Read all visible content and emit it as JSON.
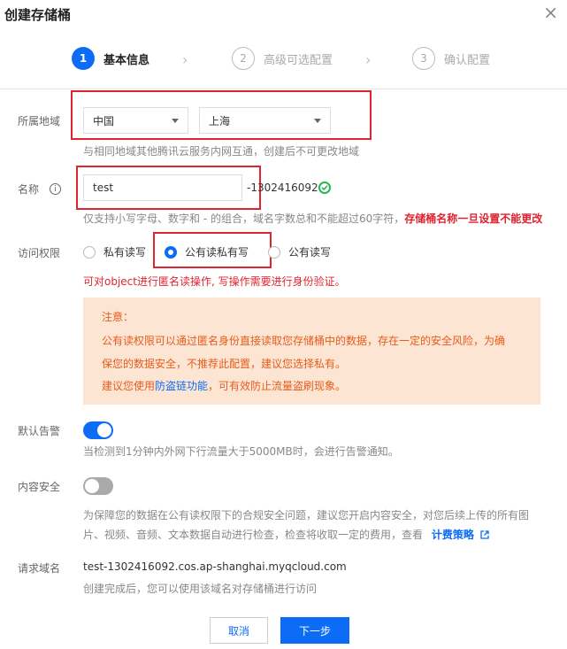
{
  "dialog": {
    "title": "创建存储桶",
    "close_glyph": "×"
  },
  "steps": [
    {
      "num": "1",
      "label": "基本信息"
    },
    {
      "num": "2",
      "label": "高级可选配置"
    },
    {
      "num": "3",
      "label": "确认配置"
    }
  ],
  "region": {
    "label": "所属地域",
    "country": "中国",
    "city": "上海",
    "hint": "与相同地域其他腾讯云服务内网互通，创建后不可更改地域"
  },
  "name": {
    "label": "名称",
    "value": "test",
    "suffix": "-1302416092",
    "hint": "仅支持小写字母、数字和 - 的组合，域名字数总和不能超过60字符，",
    "warning": "存储桶名称一旦设置不能更改"
  },
  "access": {
    "label": "访问权限",
    "options": [
      "私有读写",
      "公有读私有写",
      "公有读写"
    ],
    "selected": "公有读私有写",
    "hint": "可对object进行匿名读操作, 写操作需要进行身份验证。"
  },
  "notice": {
    "title": "注意：",
    "line1": "公有读权限可以通过匿名身份直接读取您存储桶中的数据，存在一定的安全风险，为确",
    "line2": "保您的数据安全，不推荐此配置，建议您选择私有。",
    "line3_prefix": "建议您使用",
    "line3_link": "防盗链功能",
    "line3_suffix": "，可有效防止流量盗刷现象。"
  },
  "alarm": {
    "label": "默认告警",
    "enabled": true,
    "hint": "当检测到1分钟内外网下行流量大于5000MB时，会进行告警通知。"
  },
  "content_security": {
    "label": "内容安全",
    "enabled": false,
    "hint_line1": "为保障您的数据在公有读权限下的合规安全问题，建议您开启内容安全，对您后续上传的所有图",
    "hint_line2": "片、视频、音频、文本数据自动进行检查，检查将收取一定的费用，查看",
    "link": "计费策略"
  },
  "domain": {
    "label": "请求域名",
    "value": "test-1302416092.cos.ap-shanghai.myqcloud.com",
    "hint": "创建完成后，您可以使用该域名对存储桶进行访问"
  },
  "buttons": {
    "cancel": "取消",
    "next": "下一步"
  },
  "colors": {
    "primary": "#0c6cf5",
    "warning_text": "#e65c1c",
    "danger": "#e0242f",
    "success": "#29b352"
  }
}
